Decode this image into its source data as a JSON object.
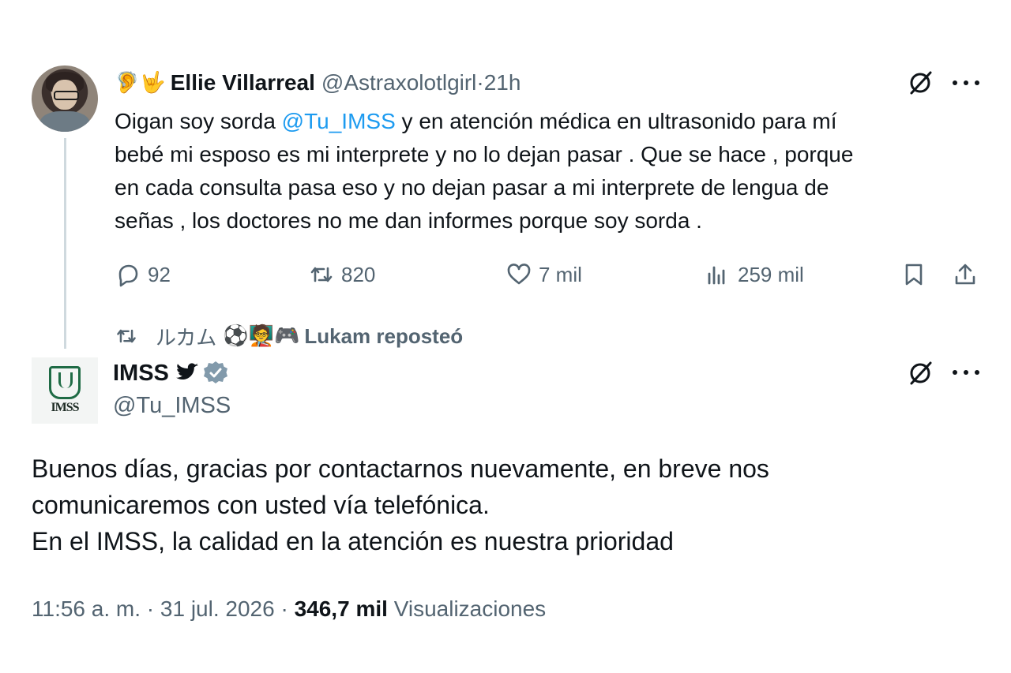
{
  "tweet1": {
    "emojis": "🦻🤟",
    "author_name": "Ellie Villarreal",
    "handle": "@Astraxolotlgirl",
    "separator": " · ",
    "time": "21h",
    "text_before_mention": "Oigan soy sorda ",
    "mention": "@Tu_IMSS",
    "text_line1_after": "  y en atención médica en ultrasonido para mí",
    "text_line2": "bebé mi esposo es mi interprete y no lo dejan pasar . Que se hace , porque",
    "text_line3": "en cada consulta pasa eso y no dejan pasar a mi interprete de lengua de",
    "text_line4": "señas , los doctores no me dan informes porque soy sorda .",
    "actions": {
      "replies": "92",
      "reposts": "820",
      "likes": "7 mil",
      "views": "259 mil"
    },
    "icons": [
      "grok-icon",
      "more-icon",
      "reply-icon",
      "repost-icon",
      "like-icon",
      "views-icon",
      "bookmark-icon",
      "share-icon"
    ]
  },
  "repost_line": {
    "reposter_jp": "ルカム",
    "reposter_emojis": "⚽🧑‍🏫🎮",
    "text": "Lukam reposteó"
  },
  "tweet2": {
    "author_name": "IMSS",
    "handle": "@Tu_IMSS",
    "avatar_label": "IMSS",
    "text_line1": "Buenos días, gracias por contactarnos nuevamente, en breve nos",
    "text_line2": "comunicaremos con usted vía telefónica.",
    "text_line3": "En el IMSS, la calidad en la atención es nuestra prioridad",
    "time": "11:56 a. m.",
    "date_sep": " · ",
    "date": "31 jul. 2026",
    "views_sep": " · ",
    "views": "346,7 mil",
    "views_label": "Visualizaciones"
  },
  "colors": {
    "text": "#0f1419",
    "secondary": "#536471",
    "link": "#1d9bf0",
    "thread_line": "#cfd9de",
    "verified": "#829aab"
  }
}
